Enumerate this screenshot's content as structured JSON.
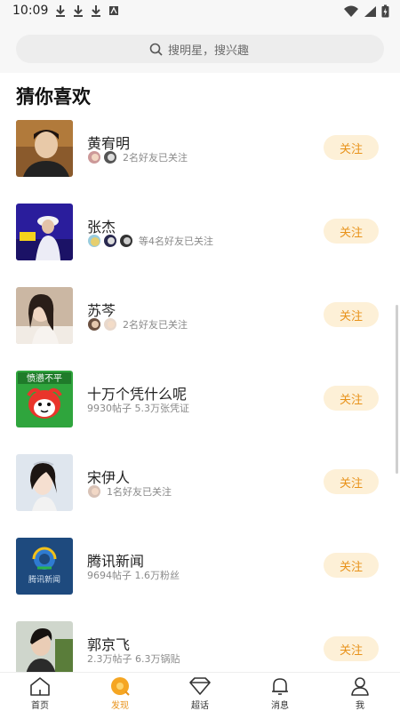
{
  "status": {
    "time": "10:09"
  },
  "search": {
    "placeholder": "搜明星，搜兴趣"
  },
  "section_title": "猜你喜欢",
  "follow_label": "关注",
  "items": [
    {
      "name": "黄宥明",
      "sub": "2名好友已关注",
      "friends": 2,
      "icon": "celebrity-photo"
    },
    {
      "name": "张杰",
      "sub": "等4名好友已关注",
      "friends": 3,
      "icon": "celebrity-photo"
    },
    {
      "name": "苏芩",
      "sub": "2名好友已关注",
      "friends": 2,
      "icon": "celebrity-photo"
    },
    {
      "name": "十万个凭什么呢",
      "sub": "9930帖子 5.3万张凭证",
      "friends": 0,
      "icon": "cartoon-mascot"
    },
    {
      "name": "宋伊人",
      "sub": "1名好友已关注",
      "friends": 1,
      "icon": "celebrity-photo"
    },
    {
      "name": "腾讯新闻",
      "sub": "9694帖子 1.6万粉丝",
      "friends": 0,
      "icon": "news-logo"
    },
    {
      "name": "郭京飞",
      "sub": "2.3万帖子 6.3万锅贴",
      "friends": 0,
      "icon": "celebrity-photo"
    }
  ],
  "tabs": [
    {
      "label": "首页",
      "icon": "home-icon",
      "active": false
    },
    {
      "label": "发现",
      "icon": "discover-icon",
      "active": true
    },
    {
      "label": "超话",
      "icon": "diamond-icon",
      "active": false
    },
    {
      "label": "消息",
      "icon": "bell-icon",
      "active": false
    },
    {
      "label": "我",
      "icon": "profile-icon",
      "active": false
    }
  ],
  "colors": {
    "accent": "#e8921a",
    "follow_bg": "#fdf0d7"
  }
}
